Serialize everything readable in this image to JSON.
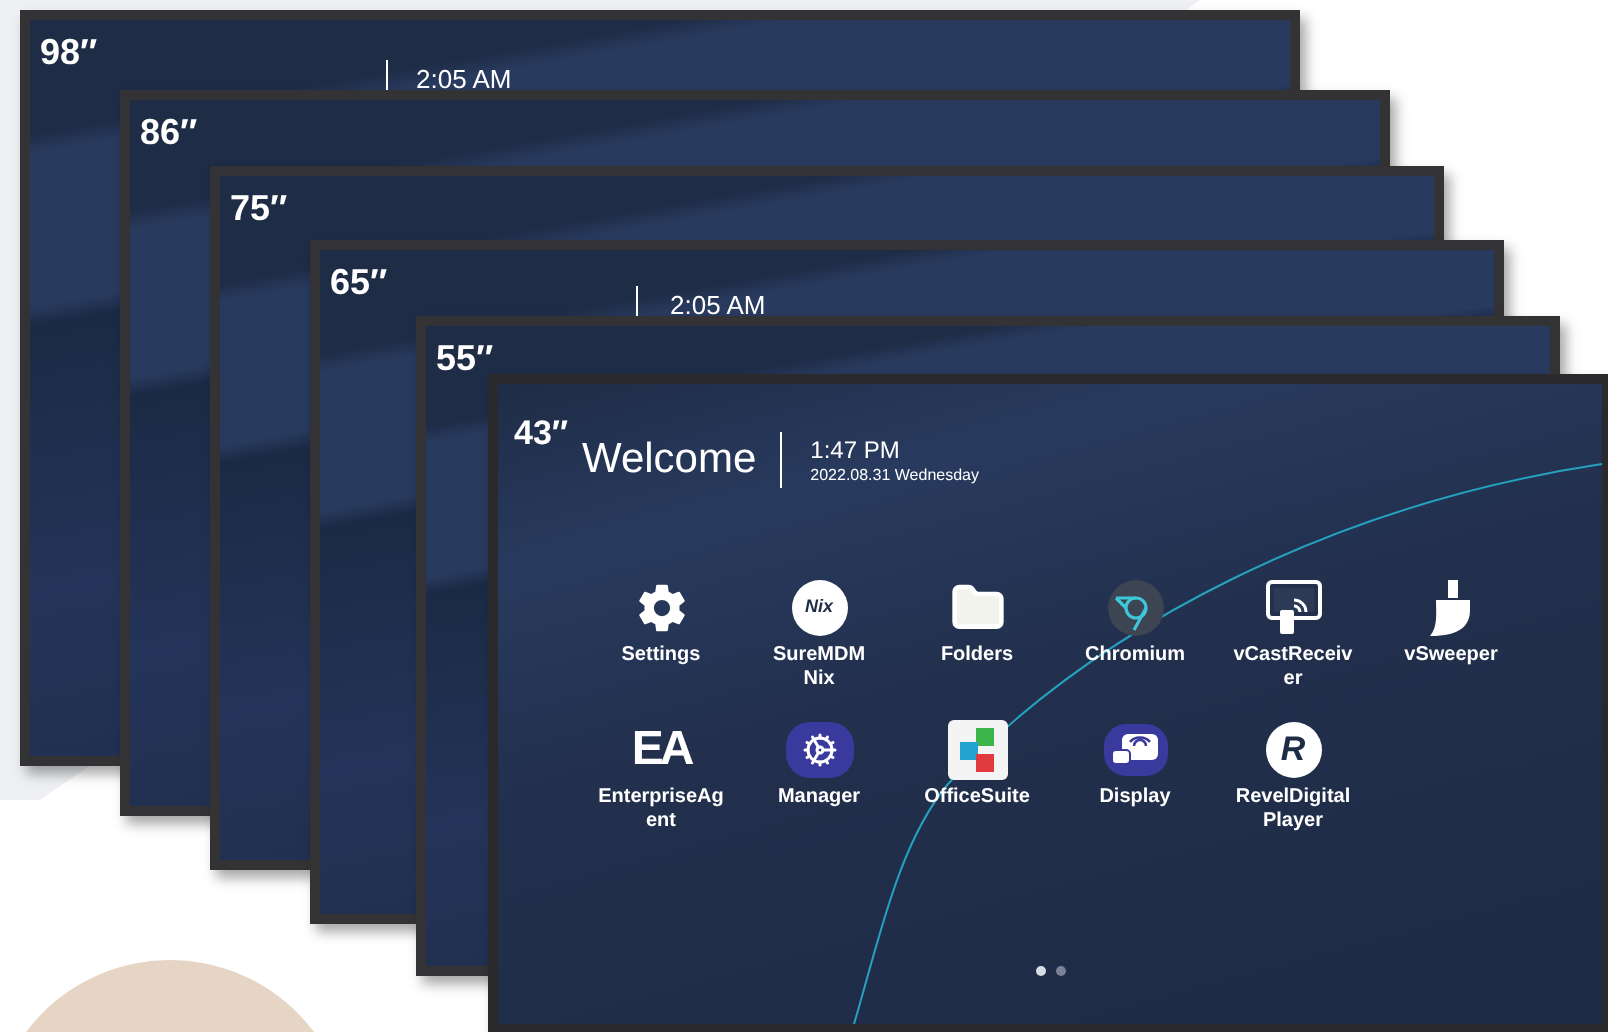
{
  "displays": [
    {
      "size": "98″",
      "time": "2:05 AM"
    },
    {
      "size": "86″"
    },
    {
      "size": "75″"
    },
    {
      "size": "65″",
      "time": "2:05 AM"
    },
    {
      "size": "55″"
    }
  ],
  "front_display": {
    "size": "43″",
    "welcome": "Welcome",
    "time": "1:47 PM",
    "date": "2022.08.31 Wednesday",
    "apps": [
      {
        "lines": [
          "Settings"
        ]
      },
      {
        "lines": [
          "SureMDM",
          "Nix"
        ],
        "icon_text": "Nix"
      },
      {
        "lines": [
          "Folders"
        ]
      },
      {
        "lines": [
          "Chromium"
        ]
      },
      {
        "lines": [
          "vCastReceiv",
          "er"
        ]
      },
      {
        "lines": [
          "vSweeper"
        ]
      },
      {
        "lines": [
          "EnterpriseAg",
          "ent"
        ],
        "icon_text": "EA"
      },
      {
        "lines": [
          "Manager"
        ]
      },
      {
        "lines": [
          "OfficeSuite"
        ]
      },
      {
        "lines": [
          "Display"
        ]
      },
      {
        "lines": [
          "RevelDigital",
          "Player"
        ],
        "icon_text": "R"
      }
    ],
    "page_dots": [
      {
        "selected": true
      },
      {
        "selected": false
      }
    ]
  }
}
